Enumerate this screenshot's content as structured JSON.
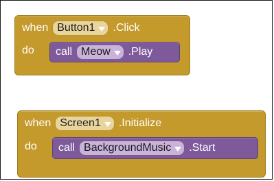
{
  "blocks": [
    {
      "when_label": "when",
      "component": "Button1",
      "event": ".Click",
      "do_label": "do",
      "call_label": "call",
      "call_component": "Meow",
      "method": ".Play"
    },
    {
      "when_label": "when",
      "component": "Screen1",
      "event": ".Initialize",
      "do_label": "do",
      "call_label": "call",
      "call_component": "BackgroundMusic",
      "method": ".Start"
    }
  ],
  "colors": {
    "event_block": "#c49a2c",
    "call_block": "#7e5a9b",
    "event_dropdown": "#e9d49c",
    "call_dropdown": "#c9b3d9"
  },
  "icons": {
    "dropdown": "chevron-down-icon"
  }
}
